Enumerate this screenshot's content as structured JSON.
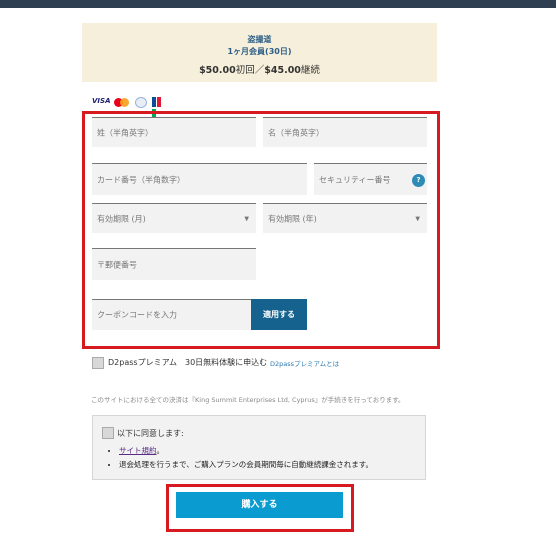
{
  "plan": {
    "name": "盗撮道",
    "sub": "1ヶ月会員(30日)",
    "price_first": "$50.00",
    "price_first_suffix": "初回／",
    "price_continue": "$45.00",
    "price_continue_suffix": "継続"
  },
  "card_logos": [
    "VISA",
    "MasterCard",
    "AMEX",
    "JCB"
  ],
  "form": {
    "last_name_placeholder": "姓（半角英字）",
    "first_name_placeholder": "名（半角英字）",
    "card_number_placeholder": "カード番号（半角数字）",
    "security_code_placeholder": "セキュリティー番号",
    "security_help_icon": "?",
    "exp_month": "有効期限 (月)",
    "exp_year": "有効期限 (年)",
    "postal_placeholder": "〒郵便番号",
    "coupon_placeholder": "クーポンコードを入力",
    "coupon_button": "適用する"
  },
  "premium": {
    "label": "D2passプレミアム　30日無料体験に申込む",
    "link": "D2passプレミアムとは"
  },
  "notice": "このサイトにおける全ての決済は『King Summit Enterprises Ltd, Cyprus』が手続きを行っております。",
  "agree": {
    "label": "以下に同意します:",
    "terms_link": "サイト規約",
    "terms_suffix": "。",
    "renewal_text": "退会処理を行うまで、ご購入プランの会員期間毎に自動継続課金されます。"
  },
  "buy_button": "購入する",
  "colors": {
    "top_bar": "#2f3f52",
    "plan_bg": "#f6efdb",
    "highlight": "#d71920",
    "coupon_button": "#16628f",
    "buy_button": "#0a9bd0"
  }
}
